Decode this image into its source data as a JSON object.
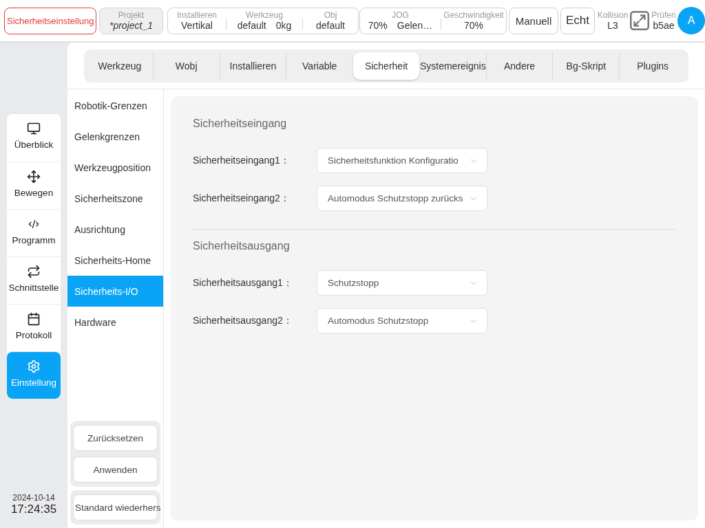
{
  "header": {
    "mode": "Sicherheitseinstellung",
    "project": {
      "label": "Projekt",
      "value": "*project_1"
    },
    "status_groups": [
      [
        {
          "label": "Installieren",
          "values": [
            "Vertikal"
          ]
        },
        {
          "label": "Werkzeug",
          "values": [
            "default",
            "0kg"
          ]
        },
        {
          "label": "Obj",
          "values": [
            "default"
          ]
        }
      ],
      [
        {
          "label": "JOG",
          "values": [
            "70%",
            "Gelen…"
          ]
        },
        {
          "label": "Geschwindigkeit",
          "values": [
            "70%"
          ]
        }
      ]
    ],
    "buttons": [
      "Manuell",
      "Echt"
    ],
    "collision": {
      "label": "Kollision",
      "value": "L3"
    },
    "check": {
      "label": "Prüfen",
      "value": "b5ae"
    },
    "avatar": "A"
  },
  "nav": [
    {
      "label": "Überblick",
      "selected": false
    },
    {
      "label": "Bewegen",
      "selected": false
    },
    {
      "label": "Programm",
      "selected": false
    },
    {
      "label": "Schnittstelle",
      "selected": false
    },
    {
      "label": "Protokoll",
      "selected": false
    },
    {
      "label": "Einstellung",
      "selected": true
    }
  ],
  "datetime": {
    "date": "2024-10-14",
    "time": "17:24:35"
  },
  "tabs": [
    {
      "label": "Werkzeug",
      "selected": false
    },
    {
      "label": "Wobj",
      "selected": false
    },
    {
      "label": "Installieren",
      "selected": false
    },
    {
      "label": "Variable",
      "selected": false
    },
    {
      "label": "Sicherheit",
      "selected": true
    },
    {
      "label": "Systemereignis",
      "selected": false
    },
    {
      "label": "Andere",
      "selected": false
    },
    {
      "label": "Bg-Skript",
      "selected": false
    },
    {
      "label": "Plugins",
      "selected": false
    }
  ],
  "settings_menu": [
    {
      "label": "Robotik-Grenzen",
      "selected": false
    },
    {
      "label": "Gelenkgrenzen",
      "selected": false
    },
    {
      "label": "Werkzeugposition",
      "selected": false
    },
    {
      "label": "Sicherheitszone",
      "selected": false
    },
    {
      "label": "Ausrichtung",
      "selected": false
    },
    {
      "label": "Sicherheits-Home",
      "selected": false
    },
    {
      "label": "Sicherheits-I/O",
      "selected": true
    },
    {
      "label": "Hardware",
      "selected": false
    }
  ],
  "action_groups": [
    [
      "Zurücksetzen",
      "Anwenden"
    ],
    [
      "Standard wiederhers"
    ]
  ],
  "sections": [
    {
      "title": "Sicherheitseingang",
      "fields": [
        {
          "label": "Sicherheitseingang1：",
          "value": "Sicherheitsfunktion Konfiguratio"
        },
        {
          "label": "Sicherheitseingang2：",
          "value": "Automodus Schutzstopp zurücks"
        }
      ]
    },
    {
      "title": "Sicherheitsausgang",
      "fields": [
        {
          "label": "Sicherheitsausgang1：",
          "value": "Schutzstopp"
        },
        {
          "label": "Sicherheitsausgang2：",
          "value": "Automodus Schutzstopp"
        }
      ]
    }
  ]
}
